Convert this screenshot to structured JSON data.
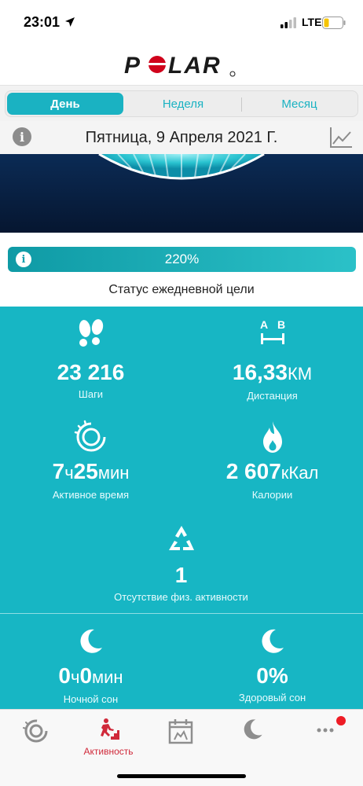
{
  "status_bar": {
    "time": "23:01",
    "network": "LTE"
  },
  "brand": {
    "logo_text": "POLAR"
  },
  "segments": [
    {
      "label": "День",
      "active": true
    },
    {
      "label": "Неделя",
      "active": false
    },
    {
      "label": "Месяц",
      "active": false
    }
  ],
  "date": {
    "text": "Пятница, 9 Апреля 2021 Г."
  },
  "goal": {
    "percent_text": "220%",
    "label": "Статус ежедневной цели"
  },
  "stats": {
    "steps": {
      "value": "23 216",
      "label": "Шаги",
      "icon": "footsteps-icon"
    },
    "distance": {
      "value": "16,33",
      "unit": "КМ",
      "label": "Дистанция",
      "icon": "distance-ab-icon"
    },
    "active_time": {
      "h": "7",
      "h_unit": "ч",
      "m": "25",
      "m_unit": "мин",
      "label": "Активное время",
      "icon": "activity-ring-icon"
    },
    "calories": {
      "value": "2 607",
      "unit": "кКал",
      "label": "Калории",
      "icon": "flame-icon"
    },
    "inactivity": {
      "value": "1",
      "label": "Отсутствие физ. активности",
      "icon": "recycle-triangle-icon"
    },
    "night_sleep": {
      "h": "0",
      "h_unit": "ч",
      "m": "0",
      "m_unit": "мин",
      "label": "Ночной сон",
      "icon": "moon-icon"
    },
    "healthy_sleep": {
      "value": "0%",
      "label": "Здоровый сон",
      "icon": "moon-icon"
    }
  },
  "tabbar": {
    "items": [
      {
        "id": "today",
        "icon": "activity-ring-icon"
      },
      {
        "id": "activity",
        "icon": "running-stairs-icon",
        "label": "Активность",
        "active": true
      },
      {
        "id": "diary",
        "icon": "calendar-icon"
      },
      {
        "id": "sleep",
        "icon": "moon-icon"
      },
      {
        "id": "more",
        "icon": "more-dots-icon",
        "badge": true
      }
    ]
  },
  "colors": {
    "accent": "#17b6c4",
    "brand_red": "#d0293a",
    "banner": "#0b2b55"
  }
}
